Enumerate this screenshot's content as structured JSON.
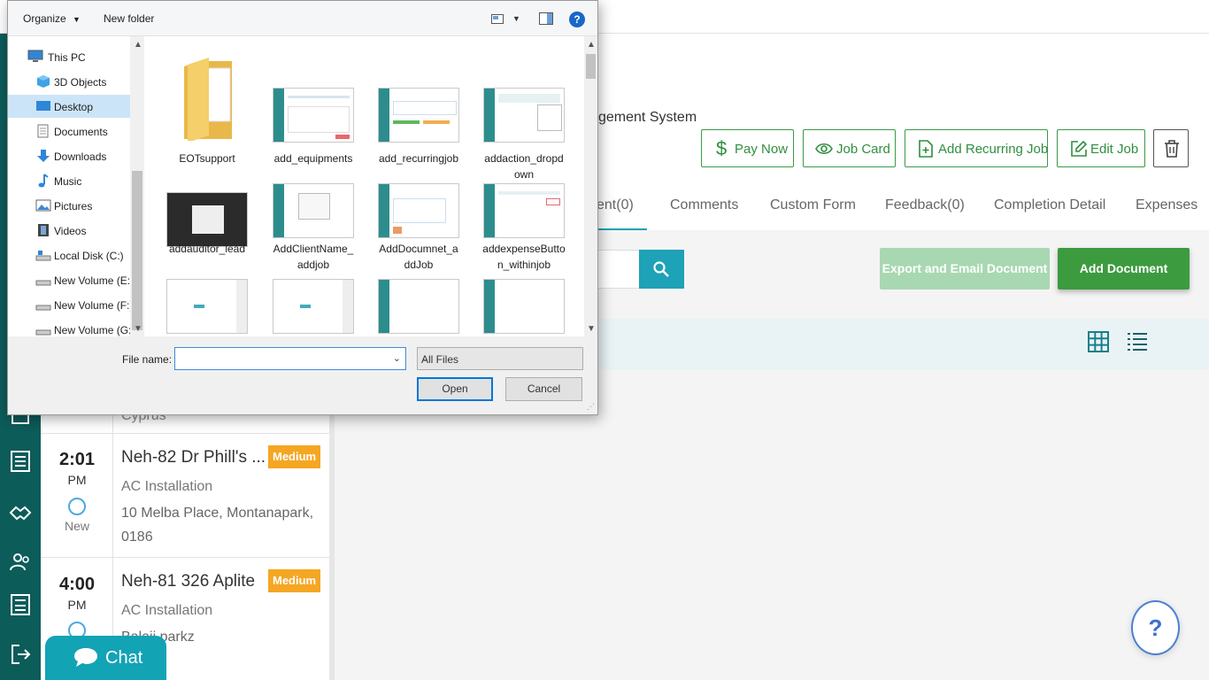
{
  "app": {
    "system_title": "gement System",
    "actions": {
      "pay_now": "Pay Now",
      "job_card": "Job Card",
      "add_recurring_job": "Add Recurring Job",
      "edit_job": "Edit Job"
    },
    "tabs": [
      "ent(0)",
      "Comments",
      "Custom Form",
      "Feedback(0)",
      "Completion Detail",
      "Expenses"
    ],
    "buttons": {
      "export_email": "Export and Email Document",
      "add_document": "Add Document"
    },
    "help_label": "?",
    "chat_label": "Chat",
    "partial_row_text": "Cyprus",
    "jobs": [
      {
        "time": "2:01",
        "ampm": "PM",
        "status": "New",
        "title": "Neh-82 Dr Phill's ...",
        "priority": "Medium",
        "type": "AC Installation",
        "address": "10 Melba Place, Montanapark, 0186"
      },
      {
        "time": "4:00",
        "ampm": "PM",
        "status": "",
        "title": "Neh-81 326 Aplite",
        "priority": "Medium",
        "type": "AC Installation",
        "address": "Balaji parkz"
      }
    ],
    "colors": {
      "nav_bg": "#0c5c5a",
      "accent_teal": "#1ea2b7",
      "green": "#3d9b3f",
      "badge_orange": "#f5a623"
    }
  },
  "dialog": {
    "toolbar": {
      "organize": "Organize",
      "new_folder": "New folder",
      "help": "?"
    },
    "nav": [
      {
        "label": "This PC",
        "icon": "computer-icon"
      },
      {
        "label": "3D Objects",
        "icon": "cube-icon"
      },
      {
        "label": "Desktop",
        "icon": "desktop-icon",
        "selected": true
      },
      {
        "label": "Documents",
        "icon": "document-icon"
      },
      {
        "label": "Downloads",
        "icon": "download-arrow-icon"
      },
      {
        "label": "Music",
        "icon": "music-note-icon"
      },
      {
        "label": "Pictures",
        "icon": "picture-icon"
      },
      {
        "label": "Videos",
        "icon": "film-icon"
      },
      {
        "label": "Local Disk (C:)",
        "icon": "drive-icon"
      },
      {
        "label": "New Volume (E:)",
        "icon": "drive-icon"
      },
      {
        "label": "New Volume (F:)",
        "icon": "drive-icon"
      },
      {
        "label": "New Volume (G:",
        "icon": "drive-icon"
      }
    ],
    "files": [
      {
        "name": "EOTsupport",
        "kind": "folder"
      },
      {
        "name": "add_equipments",
        "kind": "image"
      },
      {
        "name": "add_recurringjob",
        "kind": "image"
      },
      {
        "name": "addaction_dropdown",
        "kind": "image"
      },
      {
        "name": "addauditor_lead",
        "kind": "image-dark"
      },
      {
        "name": "AddClientName_addjob",
        "kind": "image"
      },
      {
        "name": "AddDocumnet_addJob",
        "kind": "image"
      },
      {
        "name": "addexpenseButton_withinjob",
        "kind": "image"
      },
      {
        "name": "",
        "kind": "image"
      },
      {
        "name": "",
        "kind": "image"
      },
      {
        "name": "",
        "kind": "image"
      },
      {
        "name": "",
        "kind": "image"
      }
    ],
    "file_labels": {
      "f0": "EOTsupport",
      "f1": "add_equipments",
      "f2": "add_recurringjob",
      "f3a": "addaction_dropd",
      "f3b": "own",
      "f4": "addauditor_lead",
      "f5a": "AddClientName_",
      "f5b": "addjob",
      "f6a": "AddDocumnet_a",
      "f6b": "ddJob",
      "f7a": "addexpenseButto",
      "f7b": "n_withinjob"
    },
    "file_name_label": "File name:",
    "file_name_value": "",
    "filter_value": "All Files",
    "open_label": "Open",
    "cancel_label": "Cancel"
  }
}
